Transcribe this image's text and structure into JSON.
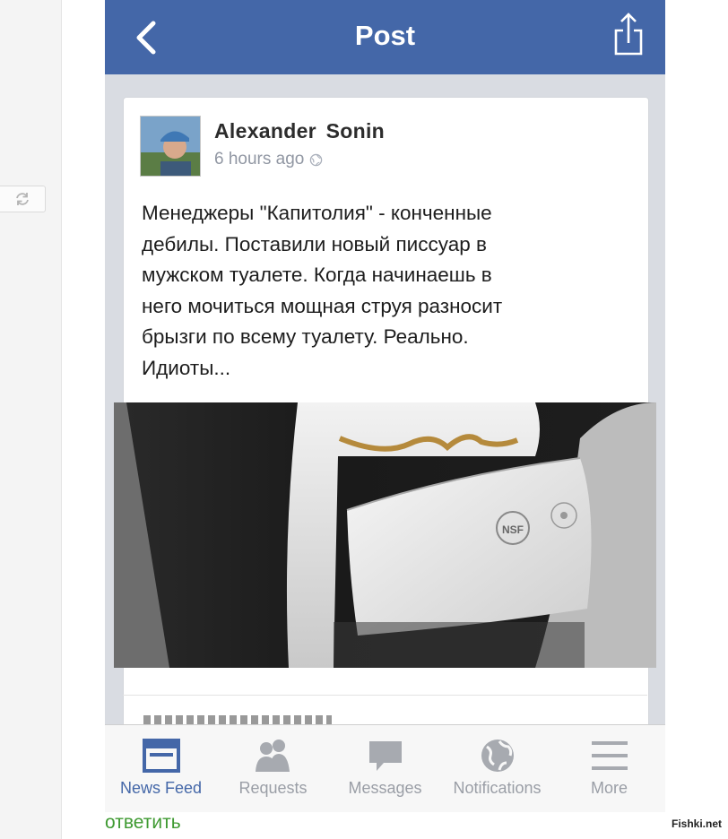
{
  "nav": {
    "title": "Post"
  },
  "post": {
    "author": "Alexander  Sonin",
    "time": "6 hours ago",
    "text_lines": [
      "Менеджеры \"Капитолия\" - конченные",
      "дебилы. Поставили новый писсуар в",
      "мужском туалете. Когда начинаешь в",
      "него мочиться мощная струя разносит",
      "брызги по всему туалету. Реально.",
      "Идиоты..."
    ],
    "image_label": "NSF"
  },
  "tabs": [
    {
      "label": "News Feed",
      "icon": "news-feed-icon",
      "active": true
    },
    {
      "label": "Requests",
      "icon": "requests-icon",
      "active": false
    },
    {
      "label": "Messages",
      "icon": "messages-icon",
      "active": false
    },
    {
      "label": "Notifications",
      "icon": "notifications-icon",
      "active": false
    },
    {
      "label": "More",
      "icon": "more-icon",
      "active": false
    }
  ],
  "page": {
    "reply_label": "ответить",
    "watermark": "Fishki.net"
  },
  "colors": {
    "nav_bg": "#4467a8",
    "active_tab": "#4467a8",
    "reply_link": "#3f9a32"
  }
}
